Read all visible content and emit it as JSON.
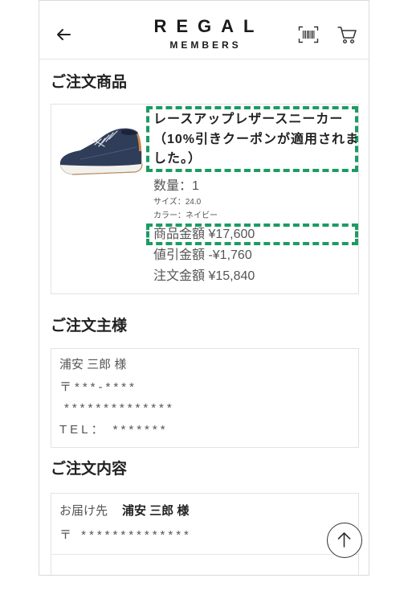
{
  "header": {
    "back_icon": "arrow-left-icon",
    "logo_main": "REGAL",
    "logo_sub": "MEMBERS",
    "barcode_icon": "barcode-scan-icon",
    "cart_icon": "cart-icon"
  },
  "order_items": {
    "title": "ご注文商品",
    "item": {
      "image_icon": "sneaker-image",
      "name_lines": [
        "レースアップレザースニーカー",
        "（10%引きクーポンが適用されま",
        "した。）"
      ],
      "quantity": "数量：1",
      "size": "サイズ：24.0",
      "color": "カラー：ネイビー",
      "subtotal": "商品金額 ¥17,600",
      "discount": "値引金額 -¥1,760",
      "total": "注文金額 ¥15,840"
    }
  },
  "orderer": {
    "title": "ご注文主様",
    "name": "浦安 三郎 様",
    "postal": "〒***-****",
    "address": "**************",
    "tel": "TEL： *******"
  },
  "order_details": {
    "title": "ご注文内容",
    "delivery_label": "お届け先",
    "delivery_name": "浦安 三郎 様",
    "delivery_address": "〒 **************"
  },
  "scroll_top_icon": "arrow-up-icon",
  "colors": {
    "highlight": "#1d9b63",
    "text": "#555555",
    "heading": "#222222",
    "border": "#e2e2e2"
  }
}
